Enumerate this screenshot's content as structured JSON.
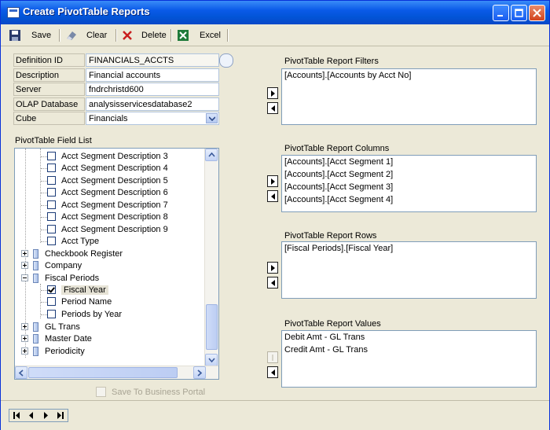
{
  "window": {
    "title": "Create PivotTable Reports"
  },
  "toolbar": {
    "save": "Save",
    "clear": "Clear",
    "delete": "Delete",
    "excel": "Excel"
  },
  "form": {
    "definition_id": {
      "label": "Definition ID",
      "value": "FINANCIALS_ACCTS"
    },
    "description": {
      "label": "Description",
      "value": "Financial accounts"
    },
    "server": {
      "label": "Server",
      "value": "fndrchristd600"
    },
    "olap_database": {
      "label": "OLAP Database",
      "value": "analysisservicesdatabase2"
    },
    "cube": {
      "label": "Cube",
      "value": "Financials"
    }
  },
  "field_list": {
    "label": "PivotTable Field List",
    "items": [
      {
        "text": "Acct Segment Description 3",
        "checked": false
      },
      {
        "text": "Acct Segment Description 4",
        "checked": false
      },
      {
        "text": "Acct Segment Description 5",
        "checked": false
      },
      {
        "text": "Acct Segment Description 6",
        "checked": false
      },
      {
        "text": "Acct Segment Description 7",
        "checked": false
      },
      {
        "text": "Acct Segment Description 8",
        "checked": false
      },
      {
        "text": "Acct Segment Description 9",
        "checked": false
      },
      {
        "text": "Acct Type",
        "checked": false
      },
      {
        "text": "Checkbook Register",
        "dimension": true,
        "expanded": false
      },
      {
        "text": "Company",
        "dimension": true,
        "expanded": false
      },
      {
        "text": "Fiscal Periods",
        "dimension": true,
        "expanded": true
      },
      {
        "text": "Fiscal Year",
        "checked": true
      },
      {
        "text": "Period Name",
        "checked": false
      },
      {
        "text": "Periods by Year",
        "checked": false
      },
      {
        "text": "GL Trans",
        "dimension": true,
        "expanded": false
      },
      {
        "text": "Master Date",
        "dimension": true,
        "expanded": false
      },
      {
        "text": "Periodicity",
        "dimension": true,
        "expanded": false
      }
    ]
  },
  "filters": {
    "label": "PivotTable Report Filters",
    "items": [
      "[Accounts].[Accounts by Acct No]"
    ]
  },
  "columns": {
    "label": "PivotTable Report Columns",
    "items": [
      "[Accounts].[Acct Segment 1]",
      "[Accounts].[Acct Segment 2]",
      "[Accounts].[Acct Segment 3]",
      "[Accounts].[Acct Segment 4]"
    ]
  },
  "rows": {
    "label": "PivotTable Report Rows",
    "items": [
      "[Fiscal Periods].[Fiscal Year]"
    ]
  },
  "values": {
    "label": "PivotTable Report Values",
    "items": [
      "Debit Amt - GL Trans",
      "Credit Amt - GL Trans"
    ]
  },
  "save_to_portal": "Save To Business Portal"
}
